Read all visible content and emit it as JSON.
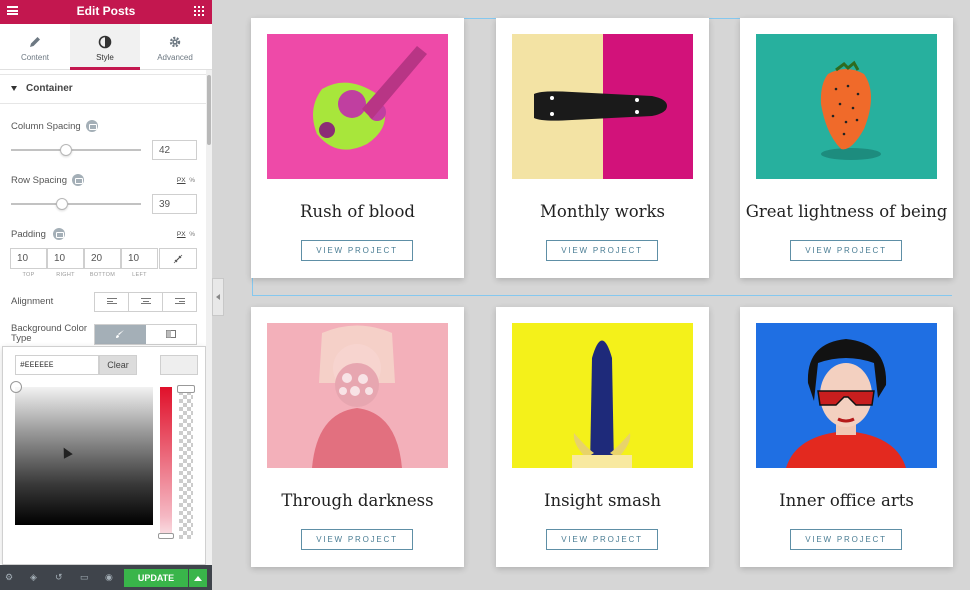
{
  "editor": {
    "title": "Edit Posts",
    "tabs": [
      {
        "label": "Content",
        "icon": "pencil-icon"
      },
      {
        "label": "Style",
        "icon": "contrast-icon"
      },
      {
        "label": "Advanced",
        "icon": "gear-icon"
      }
    ],
    "active_tab": "Style",
    "section_title": "Container",
    "column_spacing": {
      "label": "Column Spacing",
      "value": "42"
    },
    "row_spacing": {
      "label": "Row Spacing",
      "value": "39",
      "unit_px": "PX",
      "unit_pct": "%"
    },
    "padding": {
      "label": "Padding",
      "unit_px": "PX",
      "unit_pct": "%",
      "values": [
        "10",
        "10",
        "20",
        "10"
      ],
      "captions": [
        "TOP",
        "RIGHT",
        "BOTTOM",
        "LEFT"
      ]
    },
    "alignment": {
      "label": "Alignment"
    },
    "background_color_type": {
      "label": "Background Color Type"
    },
    "color_picker": {
      "hex": "#EEEEEE",
      "clear_label": "Clear",
      "palette": [
        "#6ec1e4",
        "#54595f",
        "#7a7a7a",
        "#61ce70",
        "#4054b2",
        "#23a455",
        "#000000",
        "#ffffff"
      ]
    },
    "footer": {
      "update_label": "UPDATE"
    }
  },
  "cards": [
    {
      "title": "Rush of blood",
      "button": "VIEW PROJECT",
      "image": "ice-cream-splash"
    },
    {
      "title": "Monthly works",
      "button": "VIEW PROJECT",
      "image": "skateboard"
    },
    {
      "title": "Great lightness of being",
      "button": "VIEW PROJECT",
      "image": "strawberry"
    },
    {
      "title": "Through darkness",
      "button": "VIEW PROJECT",
      "image": "woman-flowers"
    },
    {
      "title": "Insight smash",
      "button": "VIEW PROJECT",
      "image": "blue-banana"
    },
    {
      "title": "Inner office arts",
      "button": "VIEW PROJECT",
      "image": "woman-sunglasses"
    }
  ],
  "colors": {
    "brand": "#c3174f",
    "update_green": "#39b54a",
    "button_border": "#5e8fa6"
  }
}
